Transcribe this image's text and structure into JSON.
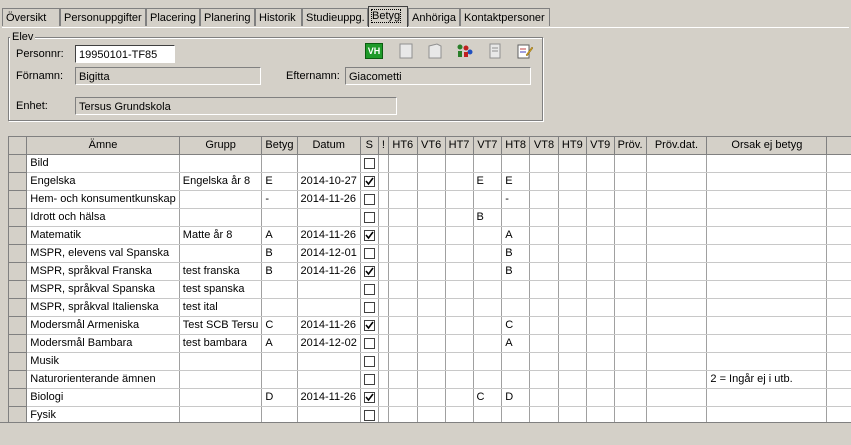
{
  "tabs": [
    {
      "label": "Översikt"
    },
    {
      "label": "Personuppgifter"
    },
    {
      "label": "Placering"
    },
    {
      "label": "Planering"
    },
    {
      "label": "Historik"
    },
    {
      "label": "Studieuppg."
    },
    {
      "label": "Betyg",
      "active": true
    },
    {
      "label": "Anhöriga"
    },
    {
      "label": "Kontaktpersoner"
    }
  ],
  "elev": {
    "legend": "Elev",
    "personnr_label": "Personnr:",
    "personnr_value": "19950101-TF85",
    "fornamn_label": "Förnamn:",
    "fornamn_value": "Bigitta",
    "efternamn_label": "Efternamn:",
    "efternamn_value": "Giacometti",
    "enhet_label": "Enhet:",
    "enhet_value": "Tersus Grundskola"
  },
  "toolbar": {
    "vh_label": "VH"
  },
  "grid": {
    "headers": [
      "",
      "Ämne",
      "Grupp",
      "Betyg",
      "Datum",
      "S",
      "!",
      "HT6",
      "VT6",
      "HT7",
      "VT7",
      "HT8",
      "VT8",
      "HT9",
      "VT9",
      "Pröv.",
      "Pröv.dat.",
      "Orsak ej betyg",
      ""
    ],
    "rows": [
      {
        "amne": "Bild",
        "grupp": "",
        "betyg": "",
        "datum": "",
        "s": false,
        "vt7": "",
        "ht8": "",
        "orsak": ""
      },
      {
        "amne": "Engelska",
        "grupp": "Engelska år 8",
        "betyg": "E",
        "datum": "2014-10-27",
        "s": true,
        "vt7": "E",
        "ht8": "E",
        "orsak": ""
      },
      {
        "amne": "Hem- och konsumentkunskap",
        "grupp": "",
        "betyg": "-",
        "datum": "2014-11-26",
        "s": false,
        "vt7": "",
        "ht8": "-",
        "orsak": ""
      },
      {
        "amne": "Idrott och hälsa",
        "grupp": "",
        "betyg": "",
        "datum": "",
        "s": false,
        "vt7": "B",
        "ht8": "",
        "orsak": ""
      },
      {
        "amne": "Matematik",
        "grupp": "Matte år 8",
        "betyg": "A",
        "datum": "2014-11-26",
        "s": true,
        "vt7": "",
        "ht8": "A",
        "orsak": ""
      },
      {
        "amne": "MSPR, elevens val Spanska",
        "grupp": "",
        "betyg": "B",
        "datum": "2014-12-01",
        "s": false,
        "vt7": "",
        "ht8": "B",
        "orsak": ""
      },
      {
        "amne": "MSPR, språkval Franska",
        "grupp": "test franska",
        "betyg": "B",
        "datum": "2014-11-26",
        "s": true,
        "vt7": "",
        "ht8": "B",
        "orsak": ""
      },
      {
        "amne": "MSPR, språkval Spanska",
        "grupp": "test spanska",
        "betyg": "",
        "datum": "",
        "s": false,
        "vt7": "",
        "ht8": "",
        "orsak": ""
      },
      {
        "amne": "MSPR, språkval Italienska",
        "grupp": "test ital",
        "betyg": "",
        "datum": "",
        "s": false,
        "vt7": "",
        "ht8": "",
        "orsak": ""
      },
      {
        "amne": "Modersmål Armeniska",
        "grupp": "Test SCB Tersu",
        "betyg": "C",
        "datum": "2014-11-26",
        "s": true,
        "vt7": "",
        "ht8": "C",
        "orsak": ""
      },
      {
        "amne": "Modersmål Bambara",
        "grupp": "test bambara",
        "betyg": "A",
        "datum": "2014-12-02",
        "s": false,
        "vt7": "",
        "ht8": "A",
        "orsak": ""
      },
      {
        "amne": "Musik",
        "grupp": "",
        "betyg": "",
        "datum": "",
        "s": false,
        "vt7": "",
        "ht8": "",
        "orsak": ""
      },
      {
        "amne": "Naturorienterande ämnen",
        "grupp": "",
        "betyg": "",
        "datum": "",
        "s": false,
        "vt7": "",
        "ht8": "",
        "orsak": "2 = Ingår ej i utb."
      },
      {
        "amne": "Biologi",
        "grupp": "",
        "betyg": "D",
        "datum": "2014-11-26",
        "s": true,
        "vt7": "C",
        "ht8": "D",
        "orsak": ""
      },
      {
        "amne": "Fysik",
        "grupp": "",
        "betyg": "",
        "datum": "",
        "s": false,
        "vt7": "",
        "ht8": "",
        "orsak": ""
      }
    ]
  }
}
